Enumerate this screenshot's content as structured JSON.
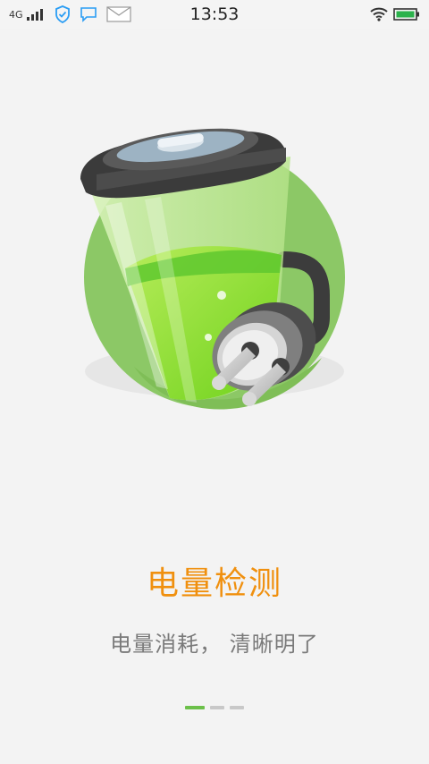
{
  "status_bar": {
    "network_type": "4G",
    "time": "13:53",
    "icons": [
      "signal-icon",
      "shield-check-icon",
      "chat-bubble-icon",
      "mail-icon",
      "wifi-icon",
      "battery-icon"
    ],
    "battery_color": "#2bb24c"
  },
  "onboarding": {
    "title": "电量检测",
    "subtitle": "电量消耗， 清晰明了",
    "hero_icon": "battery-plug-icon",
    "pages": [
      {
        "active": true
      },
      {
        "active": false
      },
      {
        "active": false
      }
    ]
  },
  "colors": {
    "title": "#f0900f",
    "subtitle": "#7a7a7a",
    "accent_green": "#6cc04a",
    "background": "#f3f3f3"
  }
}
